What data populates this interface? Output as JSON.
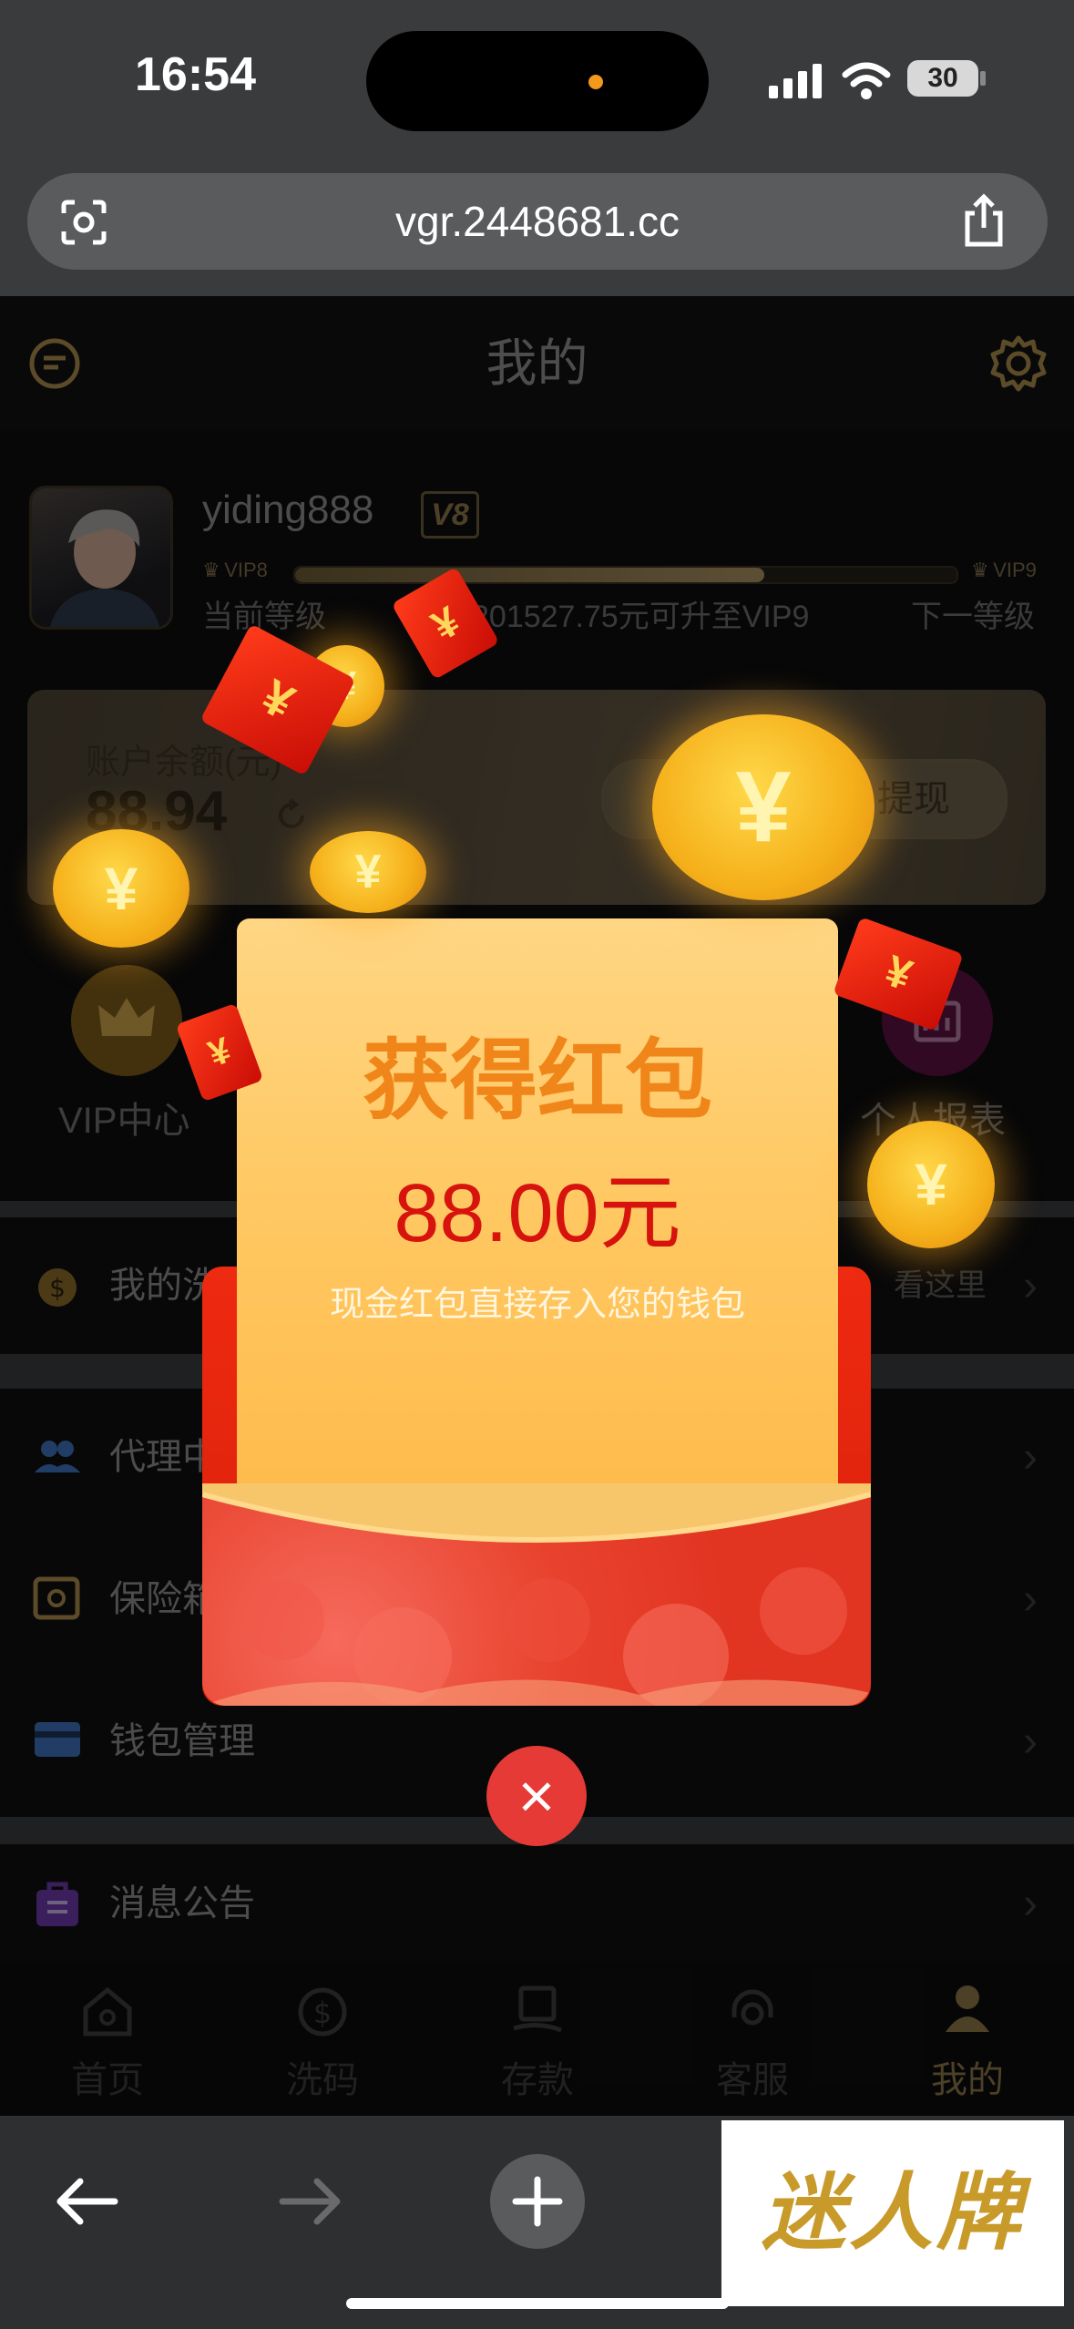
{
  "status_bar": {
    "time": "16:54",
    "battery": "30"
  },
  "browser": {
    "url": "vgr.2448681.cc"
  },
  "header": {
    "title": "我的"
  },
  "profile": {
    "username": "yiding888",
    "vip_badge": "V8",
    "current_level_tag": "VIP8",
    "next_level_tag": "VIP9",
    "current_level_label": "当前等级",
    "next_level_label": "下一等级",
    "upgrade_text": "201527.75元可升至VIP9",
    "progress_fraction": 0.71
  },
  "balance": {
    "label": "账户余额(元)",
    "value": "88.94",
    "withdraw_label": "提现"
  },
  "quick_actions": {
    "vip_center": "VIP中心",
    "personal_report": "个人报表"
  },
  "menu": {
    "rebate_label": "我的洗",
    "rebate_hint": "看这里",
    "agent_label": "代理中",
    "safe_label": "保险箱",
    "wallet_label": "钱包管理",
    "notice_label": "消息公告"
  },
  "tabs": [
    {
      "label": "首页"
    },
    {
      "label": "洗码"
    },
    {
      "label": "存款"
    },
    {
      "label": "客服"
    },
    {
      "label": "我的"
    }
  ],
  "reward_popup": {
    "title": "获得红包",
    "amount": "88.00元",
    "note": "现金红包直接存入您的钱包",
    "coin_glyph": "¥"
  },
  "watermark": "迷人牌",
  "colors": {
    "accent_gold": "#b89a5e",
    "reward_orange": "#f0861a",
    "reward_red": "#d7130e",
    "close_red": "#e53a36"
  }
}
